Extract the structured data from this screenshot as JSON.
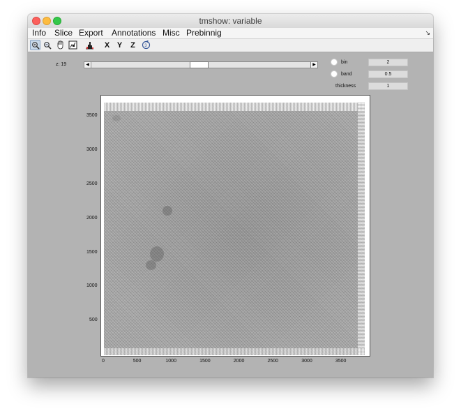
{
  "window": {
    "title": "tmshow: variable"
  },
  "menu": {
    "items": [
      "Info",
      "Slice",
      "Export",
      "Annotations",
      "Misc",
      "Prebinnig"
    ],
    "overflow_icon": "resize-arrow-icon"
  },
  "toolbar": {
    "icons": [
      "zoom-in-icon",
      "zoom-out-icon",
      "pan-hand-icon",
      "data-cursor-icon",
      "histogram-icon"
    ],
    "axis_buttons": [
      "X",
      "Y",
      "Z"
    ],
    "rotate_icon": "rotate-3d-icon"
  },
  "controls": {
    "z_label": "z: 19",
    "slider_value_fraction": 0.49,
    "bin": {
      "label": "bin",
      "value": "2"
    },
    "band": {
      "label": "band",
      "value": "0.5"
    },
    "thickness": {
      "label": "thickness",
      "value": "1"
    }
  },
  "plot": {
    "x_ticks": [
      "0",
      "500",
      "1000",
      "1500",
      "2000",
      "2500",
      "3000",
      "3500"
    ],
    "y_ticks": [
      "3500",
      "3000",
      "2500",
      "2000",
      "1500",
      "1000",
      "500"
    ],
    "x_range": [
      0,
      3840
    ],
    "y_range": [
      0,
      3710
    ]
  },
  "colors": {
    "window_bg": "#b3b3b3",
    "image_gray": "#a2a2a2"
  }
}
